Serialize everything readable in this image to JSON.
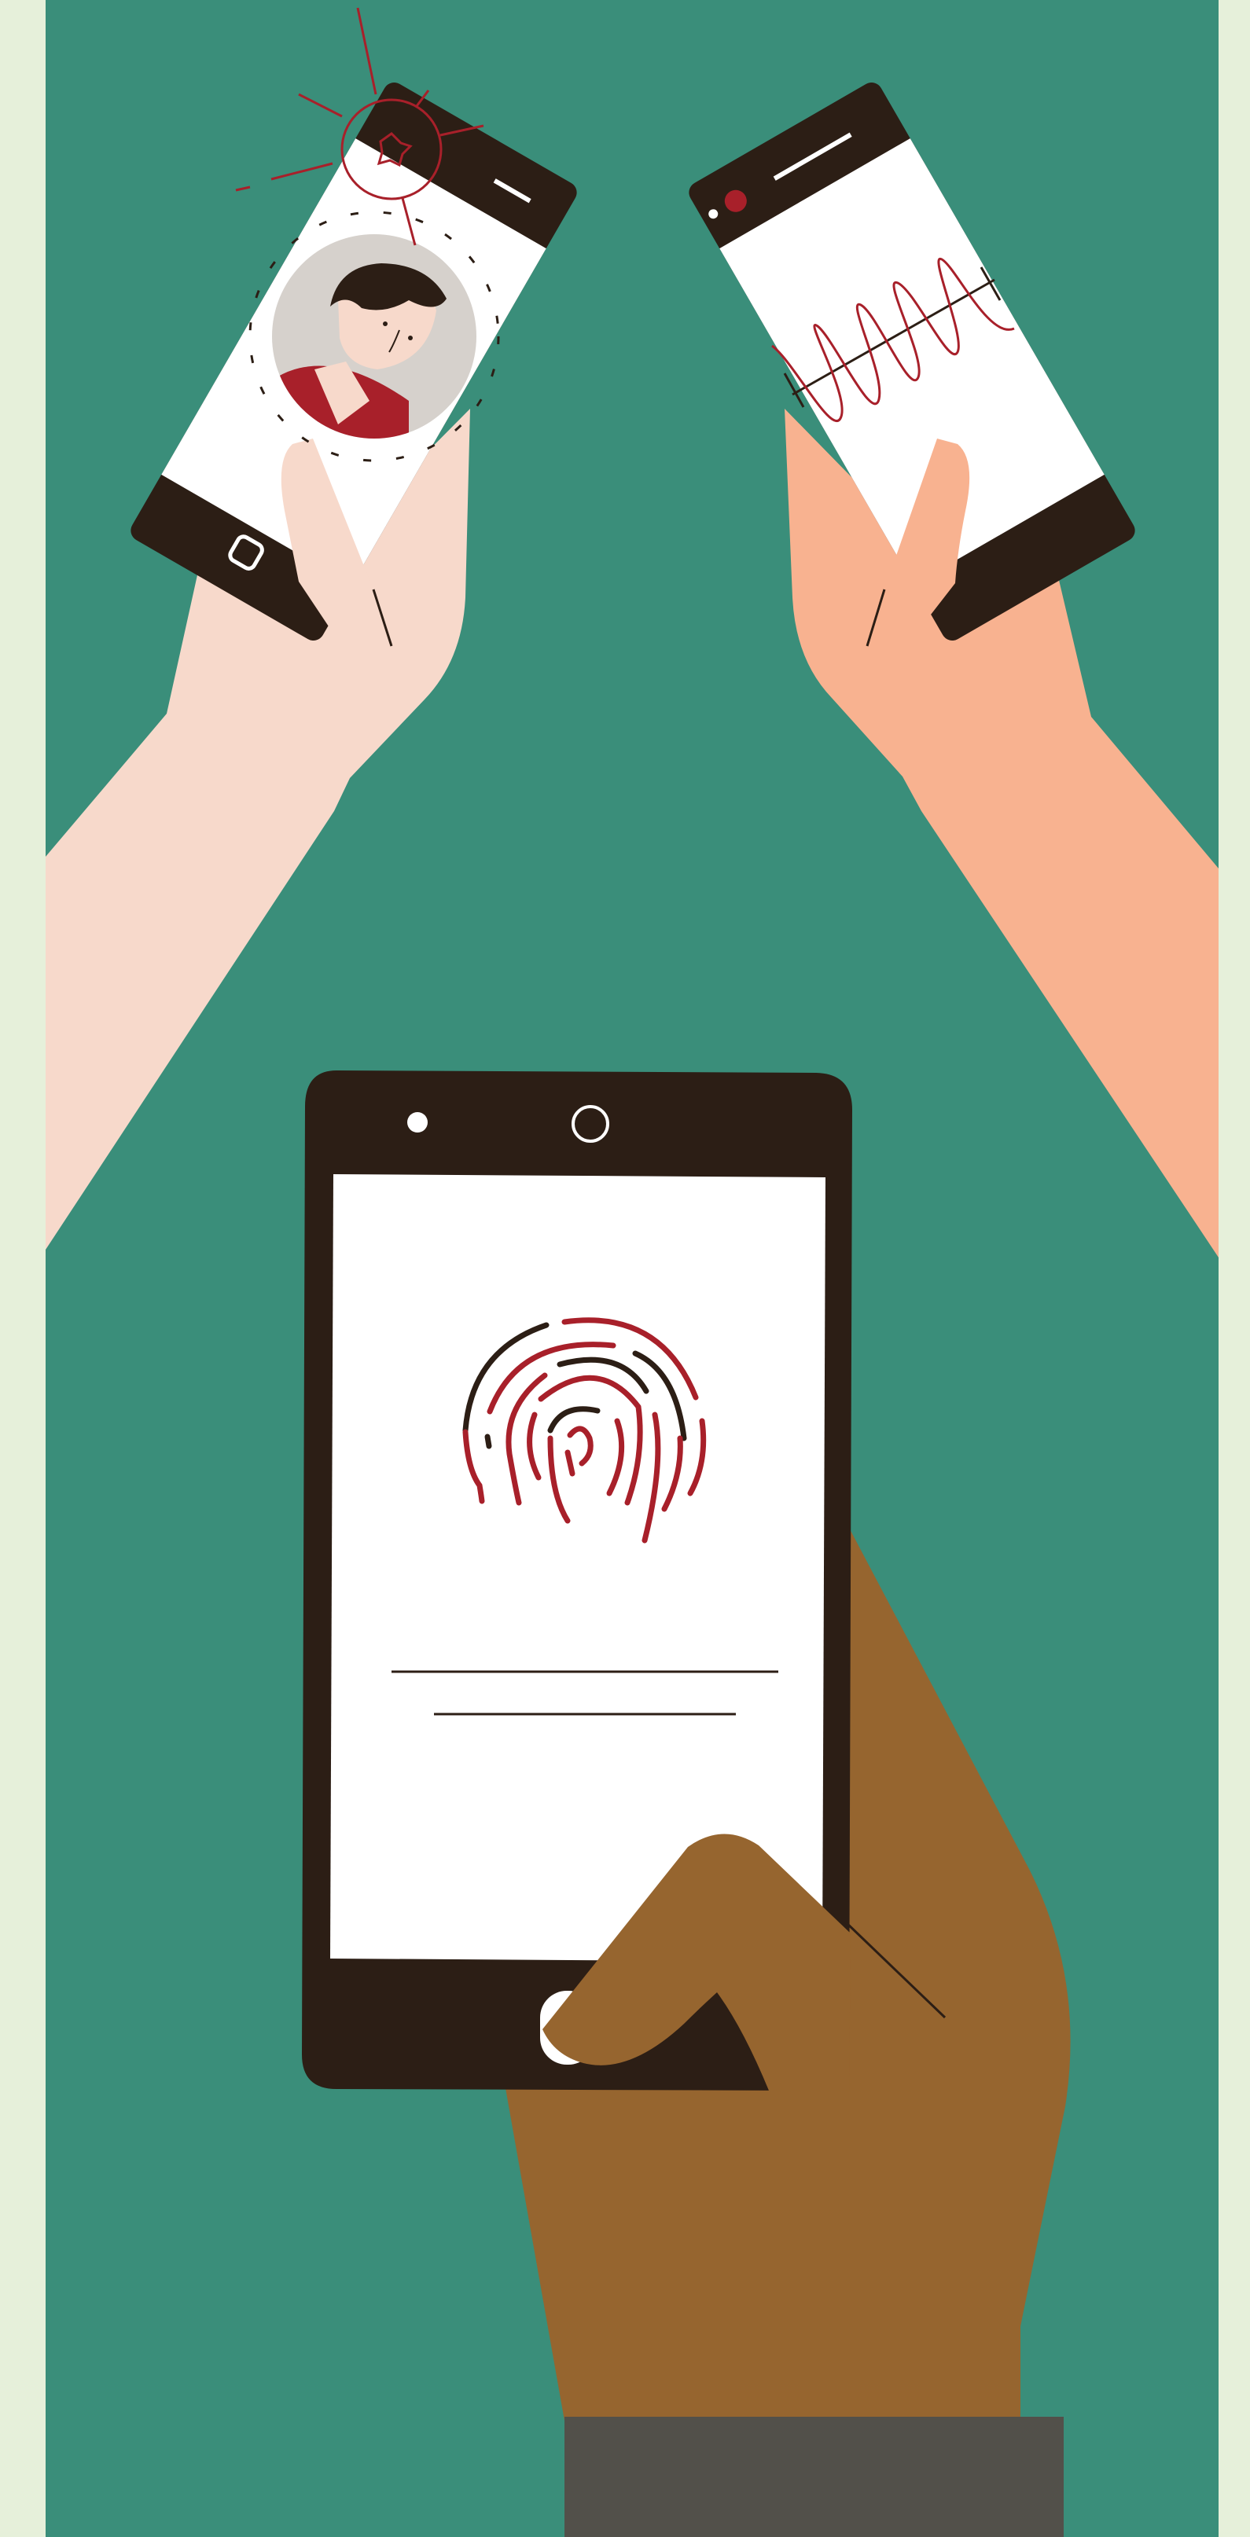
{
  "illustration": {
    "colors": {
      "page_border": "#e6f0da",
      "background": "#3a8e7a",
      "phone_body": "#2c1e15",
      "screen": "#ffffff",
      "accent_red": "#a8202a",
      "skin_light": "#f7d9cb",
      "skin_peach": "#f8b290",
      "skin_brown": "#96652f",
      "sleeve": "#52504a",
      "avatar_bg": "#d6d1cc"
    },
    "left_phone": {
      "icons": [
        "face-recognition-avatar",
        "camera-flash-icon"
      ]
    },
    "right_phone": {
      "icons": [
        "voice-waveform-icon"
      ]
    },
    "center_phone": {
      "icons": [
        "fingerprint-icon"
      ]
    }
  }
}
